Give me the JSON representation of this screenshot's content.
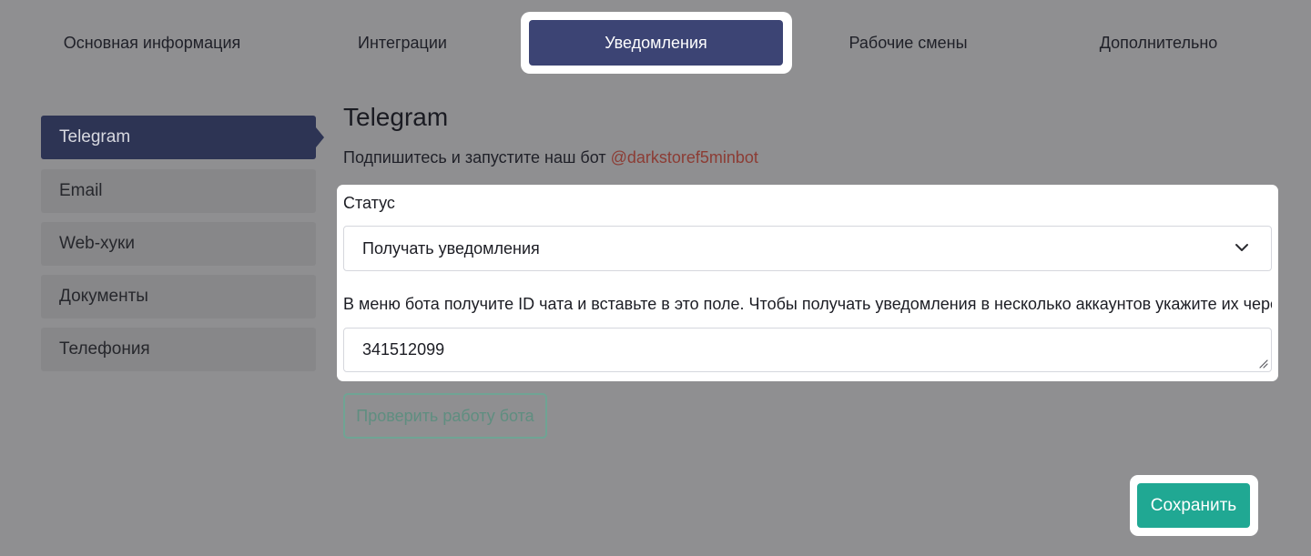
{
  "tabs": [
    {
      "label": "Основная информация"
    },
    {
      "label": "Интеграции"
    },
    {
      "label": "Уведомления",
      "active": true
    },
    {
      "label": "Рабочие смены"
    },
    {
      "label": "Дополнительно"
    }
  ],
  "sidebar": {
    "items": [
      {
        "label": "Telegram",
        "active": true
      },
      {
        "label": "Email"
      },
      {
        "label": "Web-хуки"
      },
      {
        "label": "Документы"
      },
      {
        "label": "Телефония"
      }
    ]
  },
  "main": {
    "title": "Telegram",
    "subscribe_text": "Подпишитесь и запустите наш бот ",
    "bot_handle": "@darkstoref5minbot",
    "status_label": "Статус",
    "status_value": "Получать уведомления",
    "help_text": "В меню бота получите ID чата и вставьте в это поле. Чтобы получать уведомления в несколько аккаунтов укажите их через",
    "chat_id_value": "341512099",
    "check_button_label": "Проверить работу бота",
    "save_button_label": "Сохранить"
  },
  "icons": {
    "select": "chevron-down-icon",
    "textarea": "resize-handle-icon"
  },
  "colors": {
    "active_tab": "#3c4474",
    "active_sidebar": "#2d3454",
    "save_button": "#20a893",
    "outline_button": "#6fa494",
    "bot_link": "#8c3c34"
  }
}
